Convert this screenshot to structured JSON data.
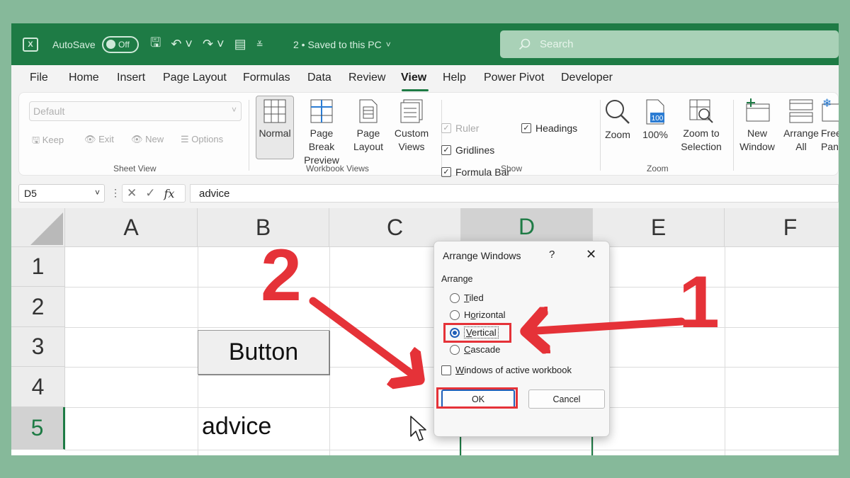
{
  "titlebar": {
    "autosave_label": "AutoSave",
    "autosave_state": "Off",
    "file_status": "2 • Saved to this PC",
    "search_placeholder": "Search"
  },
  "menu": {
    "tabs": [
      "File",
      "Home",
      "Insert",
      "Page Layout",
      "Formulas",
      "Data",
      "Review",
      "View",
      "Help",
      "Power Pivot",
      "Developer"
    ],
    "active": "View"
  },
  "ribbon": {
    "sheet_view": {
      "title": "Sheet View",
      "select_value": "Default",
      "keep": "Keep",
      "exit": "Exit",
      "new": "New",
      "options": "Options"
    },
    "workbook_views": {
      "title": "Workbook Views",
      "normal": "Normal",
      "page_break_1": "Page Break",
      "page_break_2": "Preview",
      "page_layout_1": "Page",
      "page_layout_2": "Layout",
      "custom_views_1": "Custom",
      "custom_views_2": "Views"
    },
    "show": {
      "title": "Show",
      "ruler": "Ruler",
      "gridlines": "Gridlines",
      "formula_bar": "Formula Bar",
      "headings": "Headings"
    },
    "zoom": {
      "title": "Zoom",
      "zoom": "Zoom",
      "hundred": "100%",
      "zoom_to_1": "Zoom to",
      "zoom_to_2": "Selection",
      "icon_badge": "100"
    },
    "window": {
      "new_window_1": "New",
      "new_window_2": "Window",
      "arrange_1": "Arrange",
      "arrange_2": "All",
      "freeze_1": "Free",
      "freeze_2": "Pane"
    }
  },
  "formula_bar": {
    "name_box": "D5",
    "fx": "fx",
    "value": "advice"
  },
  "sheet": {
    "columns": [
      "A",
      "B",
      "C",
      "D",
      "E",
      "F"
    ],
    "rows": [
      "1",
      "2",
      "3",
      "4",
      "5"
    ],
    "selected_column": "D",
    "selected_row": "5",
    "button_label": "Button",
    "b5": "advice",
    "d5": "advice"
  },
  "dialog": {
    "title": "Arrange Windows",
    "help": "?",
    "close": "✕",
    "group_label": "Arrange",
    "options": [
      {
        "pre": "",
        "key": "T",
        "post": "iled"
      },
      {
        "pre": "H",
        "key": "o",
        "post": "rizontal"
      },
      {
        "pre": "",
        "key": "V",
        "post": "ertical"
      },
      {
        "pre": "",
        "key": "C",
        "post": "ascade"
      }
    ],
    "selected_option": "Vertical",
    "checkbox_pre": "",
    "checkbox_key": "W",
    "checkbox_post": "indows of active workbook",
    "ok": "OK",
    "cancel": "Cancel"
  },
  "annotations": {
    "step1": "1",
    "step2": "2",
    "color": "#e53238"
  },
  "colors": {
    "excel_green": "#1e7b45",
    "background": "#86b99a",
    "accent_blue": "#1f5fb8"
  }
}
